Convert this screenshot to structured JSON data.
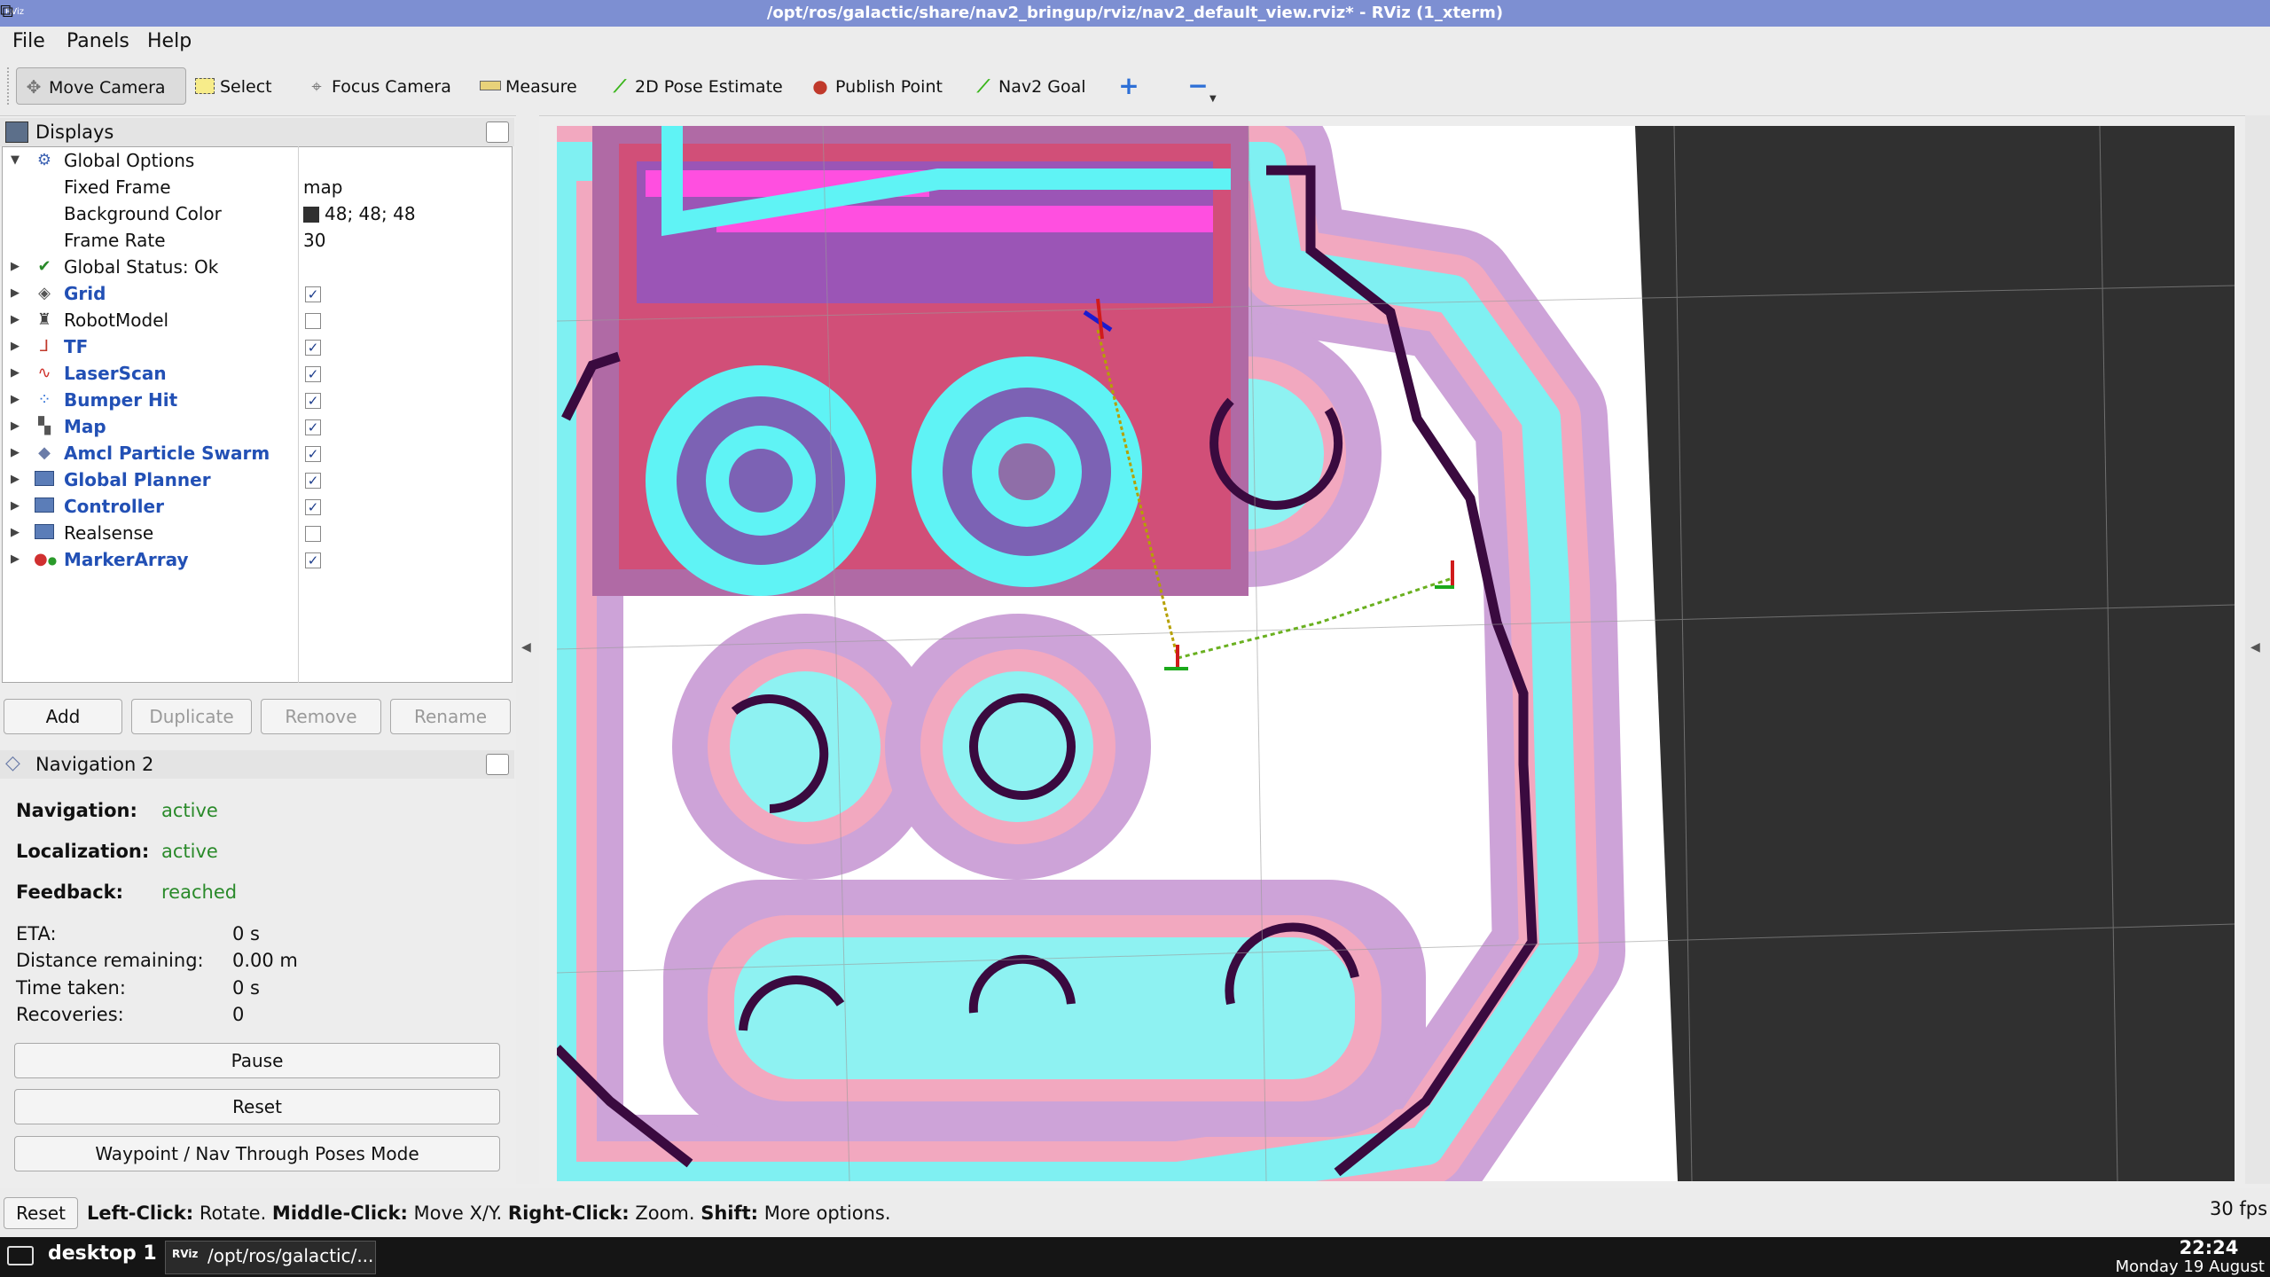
{
  "window": {
    "title": "/opt/ros/galactic/share/nav2_bringup/rviz/nav2_default_view.rviz* - RViz (1_xterm)",
    "app_icon_text": "RViz",
    "restore_icon": "restore-window-icon"
  },
  "menu": [
    "File",
    "Panels",
    "Help"
  ],
  "toolbar": {
    "move_camera": "Move Camera",
    "select": "Select",
    "focus_camera": "Focus Camera",
    "measure": "Measure",
    "pose_estimate": "2D Pose Estimate",
    "publish_point": "Publish Point",
    "nav2_goal": "Nav2 Goal",
    "add_tool_icon": "plus-icon",
    "remove_tool_icon": "minus-icon"
  },
  "displays": {
    "header": "Displays",
    "global_options": "Global Options",
    "fixed_frame_label": "Fixed Frame",
    "fixed_frame_value": "map",
    "bg_color_label": "Background Color",
    "bg_color_value": "48; 48; 48",
    "bg_color_hex": "#303030",
    "frame_rate_label": "Frame Rate",
    "frame_rate_value": "30",
    "global_status": "Global Status: Ok",
    "items": [
      {
        "label": "Grid",
        "checked": true
      },
      {
        "label": "RobotModel",
        "checked": false
      },
      {
        "label": "TF",
        "checked": true
      },
      {
        "label": "LaserScan",
        "checked": true
      },
      {
        "label": "Bumper Hit",
        "checked": true
      },
      {
        "label": "Map",
        "checked": true
      },
      {
        "label": "Amcl Particle Swarm",
        "checked": true
      },
      {
        "label": "Global Planner",
        "checked": true
      },
      {
        "label": "Controller",
        "checked": true
      },
      {
        "label": "Realsense",
        "checked": false
      },
      {
        "label": "MarkerArray",
        "checked": true
      }
    ],
    "buttons": {
      "add": "Add",
      "duplicate": "Duplicate",
      "remove": "Remove",
      "rename": "Rename"
    }
  },
  "navigation": {
    "header": "Navigation 2",
    "navigation_label": "Navigation:",
    "navigation_value": "active",
    "localization_label": "Localization:",
    "localization_value": "active",
    "feedback_label": "Feedback:",
    "feedback_value": "reached",
    "eta_label": "ETA:",
    "eta_value": "0 s",
    "distance_label": "Distance remaining:",
    "distance_value": "0.00 m",
    "time_label": "Time taken:",
    "time_value": "0 s",
    "recoveries_label": "Recoveries:",
    "recoveries_value": "0",
    "pause": "Pause",
    "reset": "Reset",
    "waypoint_mode": "Waypoint / Nav Through Poses Mode"
  },
  "statusbar": {
    "reset": "Reset",
    "left_click": "Left-Click:",
    "left_click_desc": " Rotate. ",
    "middle_click": "Middle-Click:",
    "middle_click_desc": " Move X/Y. ",
    "right_click": "Right-Click:",
    "right_click_desc": " Zoom. ",
    "shift": "Shift:",
    "shift_desc": " More options.",
    "fps": "30 fps"
  },
  "taskbar": {
    "desktop": "desktop 1",
    "task": "/opt/ros/galactic/...",
    "task_icon_text": "RViz",
    "time": "22:24",
    "date": "Monday 19 August"
  }
}
